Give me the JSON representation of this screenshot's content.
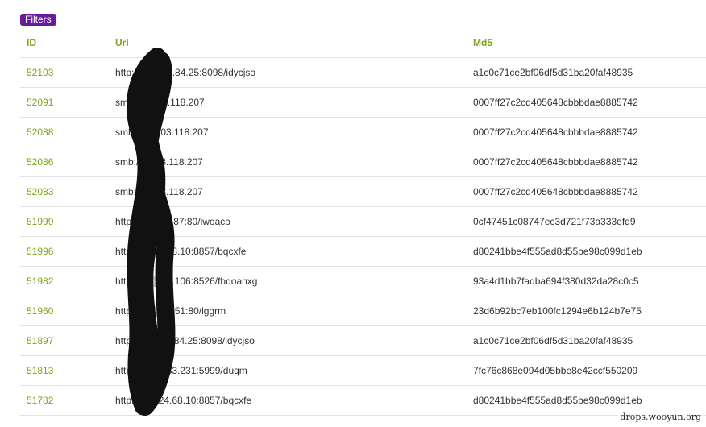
{
  "filters": {
    "label": "Filters"
  },
  "table": {
    "headers": {
      "id": "ID",
      "url": "Url",
      "md5": "Md5"
    },
    "rows": [
      {
        "id": "52103",
        "url": "http://▒▒▒▒1.84.25:8098/idycjso",
        "md5": "a1c0c71ce2bf06df5d31ba20faf48935"
      },
      {
        "id": "52091",
        "url": "smb://▒▒▒3.118.207",
        "md5": "0007ff27c2cd405648cbbbdae8885742"
      },
      {
        "id": "52088",
        "url": "smb://▒▒103.118.207",
        "md5": "0007ff27c2cd405648cbbbdae8885742"
      },
      {
        "id": "52086",
        "url": "smb://▒▒03.118.207",
        "md5": "0007ff27c2cd405648cbbbdae8885742"
      },
      {
        "id": "52083",
        "url": "smb://▒▒03.118.207",
        "md5": "0007ff27c2cd405648cbbbdae8885742"
      },
      {
        "id": "51999",
        "url": "http://▒▒▒36.87:80/iwoaco",
        "md5": "0cf47451c08747ec3d721f73a333efd9"
      },
      {
        "id": "51996",
        "url": "http://22.▒▒68.10:8857/bqcxfe",
        "md5": "d80241bbe4f555ad8d55be98c099d1eb"
      },
      {
        "id": "51982",
        "url": "http://33.▒▒0.106:8526/fbdoanxg",
        "md5": "93a4d1bb7fadba694f380d32da28c0c5"
      },
      {
        "id": "51960",
        "url": "http://17.▒▒9.51:80/lggrm",
        "md5": "23d6b92bc7eb100fc1294e6b124b7e75"
      },
      {
        "id": "51897",
        "url": "http://11.▒▒1.84.25:8098/idycjso",
        "md5": "a1c0c71ce2bf06df5d31ba20faf48935"
      },
      {
        "id": "51813",
        "url": "http://▒▒9.183.231:5999/duqm",
        "md5": "7fc76c868e094d05bbe8e42ccf550209"
      },
      {
        "id": "51782",
        "url": "http://▒▒224.68.10:8857/bqcxfe",
        "md5": "d80241bbe4f555ad8d55be98c099d1eb"
      }
    ]
  },
  "watermark": "drops.wooyun.org",
  "colors": {
    "accent": "#7fa41d",
    "filters_bg": "#6a1b9a",
    "scribble": "#111111"
  }
}
